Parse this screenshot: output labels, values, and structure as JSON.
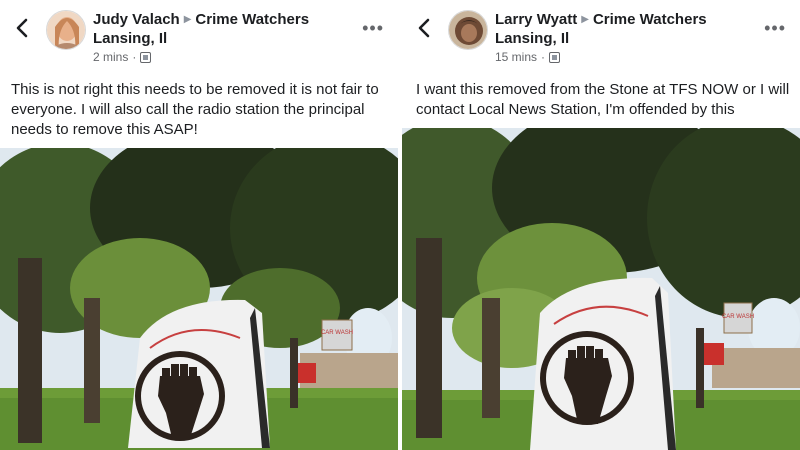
{
  "posts": [
    {
      "author": "Judy Valach",
      "group": "Crime Watchers",
      "location": "Lansing, Il",
      "time": "2 mins",
      "text": "This is not right this needs to be removed it is not fair to everyone. I will also call the radio station the principal needs to remove this ASAP!",
      "avatar_color": "#d9a37c"
    },
    {
      "author": "Larry Wyatt",
      "group": "Crime Watchers",
      "location": "Lansing, Il",
      "time": "15 mins",
      "text": "I want this removed from the Stone at TFS NOW or I will contact Local News Station, I'm offended by this",
      "avatar_color": "#7a4f3a"
    }
  ],
  "photo_signs": {
    "car_wash": "CAR WASH"
  },
  "colors": {
    "grass": "#6f9e3a",
    "tree_dark": "#2d3a1e",
    "sky": "#e6eef5",
    "rock": "#f2f2f2",
    "fist": "#2b211b"
  }
}
